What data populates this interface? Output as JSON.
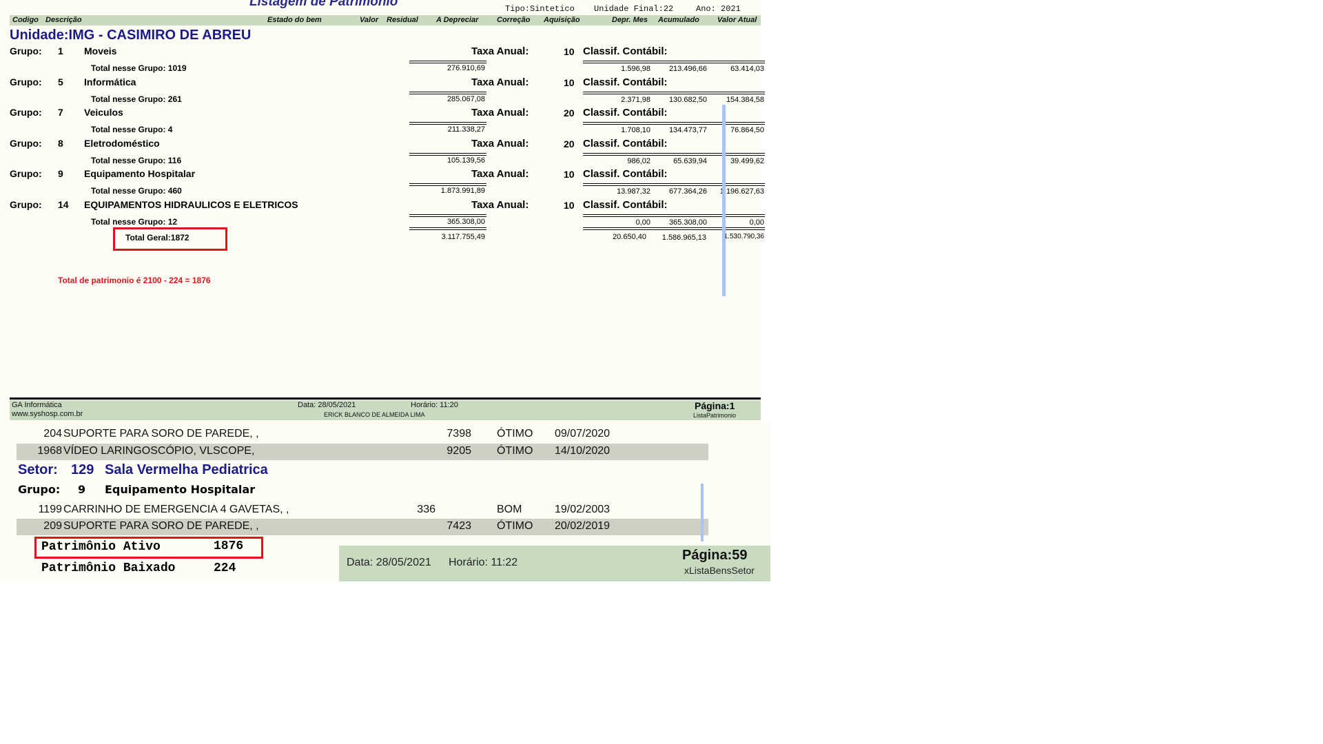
{
  "report1": {
    "title": "Listagem de Patrimonio",
    "tipo": "Tipo:Sintetico",
    "unidade_final": "Unidade Final:22",
    "ano": "Ano: 2021",
    "headers": {
      "codigo": "Codigo",
      "descricao": "Descrição",
      "estado": "Estado do bem",
      "valor": "Valor",
      "residual": "Residual",
      "a_depreciar": "A Depreciar",
      "correcao": "Correção",
      "aquisicao": "Aquisição",
      "depr_mes": "Depr. Mes",
      "acumulado": "Acumulado",
      "valor_atual": "Valor Atual"
    },
    "unidade": "Unidade:IMG - CASIMIRO DE ABREU",
    "grupo_label": "Grupo:",
    "taxa_label": "Taxa Anual:",
    "classif_label": "Classif. Contábil:",
    "groups": [
      {
        "num": "1",
        "name": "Moveis",
        "taxa": "10",
        "total": "Total nesse Grupo: 1019",
        "a_depreciar": "276.910,69",
        "depr_mes": "1.596,98",
        "acumulado": "213.496,66",
        "valor_atual": "63.414,03"
      },
      {
        "num": "5",
        "name": "Informática",
        "taxa": "10",
        "total": "Total nesse Grupo: 261",
        "a_depreciar": "285.067,08",
        "depr_mes": "2.371,98",
        "acumulado": "130.682,50",
        "valor_atual": "154.384,58"
      },
      {
        "num": "7",
        "name": "Veiculos",
        "taxa": "20",
        "total": "Total nesse Grupo: 4",
        "a_depreciar": "211.338,27",
        "depr_mes": "1.708,10",
        "acumulado": "134.473,77",
        "valor_atual": "76.864,50"
      },
      {
        "num": "8",
        "name": "Eletrodoméstico",
        "taxa": "20",
        "total": "Total nesse Grupo: 116",
        "a_depreciar": "105.139,56",
        "depr_mes": "986,02",
        "acumulado": "65.639,94",
        "valor_atual": "39.499,62"
      },
      {
        "num": "9",
        "name": "Equipamento Hospitalar",
        "taxa": "10",
        "total": "Total nesse Grupo: 460",
        "a_depreciar": "1.873.991,89",
        "depr_mes": "13.987,32",
        "acumulado": "677.364,26",
        "valor_atual": "1.196.627,63"
      },
      {
        "num": "14",
        "name": "EQUIPAMENTOS HIDRAULICOS E ELETRICOS",
        "taxa": "10",
        "total": "Total nesse Grupo: 12",
        "a_depreciar": "365.308,00",
        "depr_mes": "0,00",
        "acumulado": "365.308,00",
        "valor_atual": "0,00"
      }
    ],
    "total_geral": "Total Geral:1872",
    "grand": {
      "a_depreciar": "3.117.755,49",
      "depr_mes": "20.650,40",
      "acumulado": "1.586.965,13",
      "valor_atual": "1.530.790,36"
    },
    "note": "Total de patrimonio é 2100 - 224 = 1876",
    "footer": {
      "company": "GA Informática",
      "site": "www.syshosp.com.br",
      "data": "Data: 28/05/2021",
      "horario": "Horário: 11:20",
      "user": "ERICK BLANCO DE ALMEIDA LIMA",
      "pagina": "Página:1",
      "report": "ListaPatrimonio"
    }
  },
  "report2": {
    "rows_top": [
      {
        "codigo": "204",
        "descricao": "SUPORTE PARA SORO DE PAREDE, ,",
        "valor": "7398",
        "estado": "ÓTIMO",
        "data": "09/07/2020"
      },
      {
        "codigo": "1968",
        "descricao": "VÍDEO LARINGOSCÓPIO, VLSCOPE,",
        "valor": "9205",
        "estado": "ÓTIMO",
        "data": "14/10/2020"
      }
    ],
    "setor_label": "Setor:",
    "setor_num": "129",
    "setor_name": "Sala Vermelha Pediatrica",
    "grupo_label": "Grupo:",
    "grupo_num": "9",
    "grupo_name": "Equipamento Hospitalar",
    "rows_bottom": [
      {
        "codigo": "1199",
        "descricao": "CARRINHO DE EMERGENCIA 4 GAVETAS, ,",
        "valor": "336",
        "estado": "BOM",
        "data": "19/02/2003"
      },
      {
        "codigo": "209",
        "descricao": "SUPORTE PARA SORO DE PAREDE, ,",
        "valor": "7423",
        "estado": "ÓTIMO",
        "data": "20/02/2019"
      }
    ],
    "ativo_label": "Patrimônio Ativo",
    "ativo_value": "1876",
    "baixado_label": "Patrimônio Baixado",
    "baixado_value": "224",
    "footer": {
      "data": "Data: 28/05/2021",
      "horario": "Horário: 11:22",
      "pagina": "Página:59",
      "report": "xListaBensSetor"
    }
  },
  "colors": {
    "highlight": "#e0141c",
    "header_band": "#c8dbc0",
    "title_blue": "#1a1a8a"
  }
}
